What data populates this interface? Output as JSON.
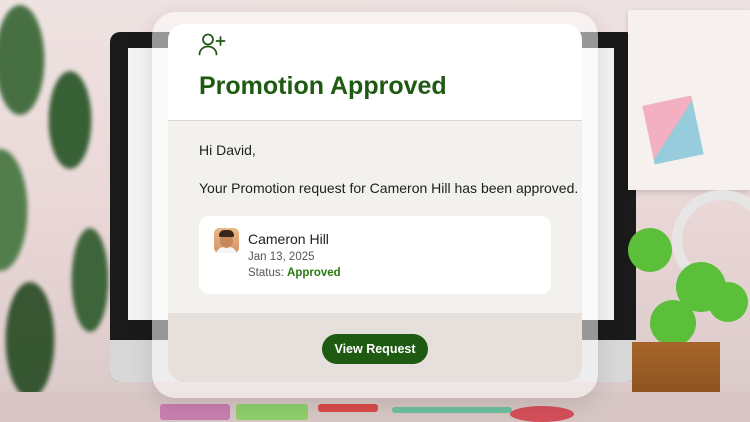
{
  "email": {
    "title": "Promotion Approved",
    "greeting": "Hi David,",
    "message": "Your Promotion request for Cameron Hill has been approved.",
    "card": {
      "name": "Cameron Hill",
      "date": "Jan 13, 2025",
      "status_label": "Status:",
      "status_value": "Approved"
    },
    "button_label": "View Request"
  },
  "icons": {
    "header": "user-add-icon"
  },
  "colors": {
    "accent": "#1f5a12",
    "status_approved": "#2a7a12",
    "footer_bg": "#e5e0db",
    "body_bg": "#f2f1ee"
  }
}
